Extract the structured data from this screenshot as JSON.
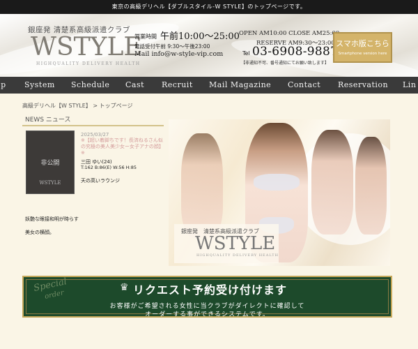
{
  "topbar": {
    "text": "東京の高級デリヘル【ダブルスタイル-W STYLE】のトップページです。"
  },
  "header": {
    "logo_tagline": "銀座発 清楚系高級派遣クラブ",
    "logo_main": "WSTYLE",
    "logo_sub": "HIGHQUALITY DELIVERY HEALTH",
    "hours_label": "営業時間",
    "hours_value": "午前10:00～25:00",
    "phone_hours": "電話受付午前 9:30～午後23:00",
    "mail": "Mail info@w-style-vip.com",
    "open_close": "OPEN AM10:00 CLOSE AM25:00",
    "reserve": "RESERVE AM9:30～23:00",
    "tel_label": "Tel",
    "tel_number": "03-6908-9887",
    "tel_note": "【非通知不可、番号通知にてお願い致します】",
    "sp_button_main": "スマホ版こちら",
    "sp_button_sub": "Smartphone version here"
  },
  "nav": {
    "items": [
      "op",
      "System",
      "Schedule",
      "Cast",
      "Recruit",
      "Mail Magazine",
      "Contact",
      "Reservation",
      "Lin"
    ]
  },
  "breadcrumb": {
    "link": "高級デリヘル【W STYLE】",
    "separator": " > ",
    "current": "トップページ"
  },
  "news": {
    "title": "NEWS ニュース",
    "photo_label": "非公開",
    "photo_logo": "WSTYLE",
    "date": "2025/03/27",
    "headline": "※【超い着脚ちです！長済ねるさん似の究極の美人美少女ー女子アナの顔】※",
    "name": "三田 ゆい(24)",
    "stats": "T:162 B:86(E) W:56 H:85",
    "comment": "天の高いラウンジ"
  },
  "descriptions": {
    "line1": "妖艶な眼接和明が時らす",
    "line2": "美女の横顔。"
  },
  "banner": {
    "tagline": "銀座発　清楚系高級派遣クラブ",
    "logo": "WSTYLE",
    "sub": "HIGHQUALITY DELIVERY HEALTH"
  },
  "request": {
    "special": "Special",
    "special2": "order",
    "crown_icon": "♛",
    "title": "リクエスト予約受け付けます",
    "line1": "お客様がご希望される女性に当クラブがダイレクトに確認して",
    "line2": "オーダーする事ができるシステムです。"
  },
  "colors": {
    "nav_bg": "#3a3a3a",
    "accent_gold": "#d4b46a",
    "request_bg": "#1d4a2b",
    "headline_pink": "#d39a9a",
    "page_bg": "#faf5e6"
  }
}
